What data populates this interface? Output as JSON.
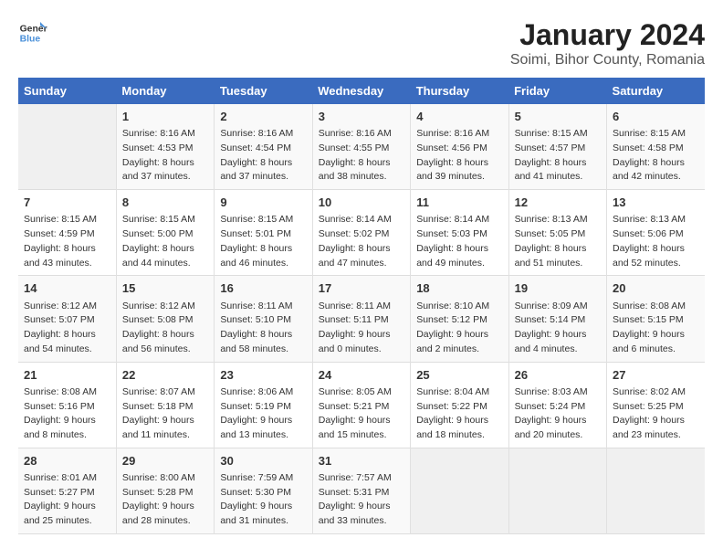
{
  "logo": {
    "text_general": "General",
    "text_blue": "Blue"
  },
  "title": "January 2024",
  "subtitle": "Soimi, Bihor County, Romania",
  "weekdays": [
    "Sunday",
    "Monday",
    "Tuesday",
    "Wednesday",
    "Thursday",
    "Friday",
    "Saturday"
  ],
  "weeks": [
    [
      {
        "day": "",
        "sunrise": "",
        "sunset": "",
        "daylight": ""
      },
      {
        "day": "1",
        "sunrise": "Sunrise: 8:16 AM",
        "sunset": "Sunset: 4:53 PM",
        "daylight": "Daylight: 8 hours and 37 minutes."
      },
      {
        "day": "2",
        "sunrise": "Sunrise: 8:16 AM",
        "sunset": "Sunset: 4:54 PM",
        "daylight": "Daylight: 8 hours and 37 minutes."
      },
      {
        "day": "3",
        "sunrise": "Sunrise: 8:16 AM",
        "sunset": "Sunset: 4:55 PM",
        "daylight": "Daylight: 8 hours and 38 minutes."
      },
      {
        "day": "4",
        "sunrise": "Sunrise: 8:16 AM",
        "sunset": "Sunset: 4:56 PM",
        "daylight": "Daylight: 8 hours and 39 minutes."
      },
      {
        "day": "5",
        "sunrise": "Sunrise: 8:15 AM",
        "sunset": "Sunset: 4:57 PM",
        "daylight": "Daylight: 8 hours and 41 minutes."
      },
      {
        "day": "6",
        "sunrise": "Sunrise: 8:15 AM",
        "sunset": "Sunset: 4:58 PM",
        "daylight": "Daylight: 8 hours and 42 minutes."
      }
    ],
    [
      {
        "day": "7",
        "sunrise": "Sunrise: 8:15 AM",
        "sunset": "Sunset: 4:59 PM",
        "daylight": "Daylight: 8 hours and 43 minutes."
      },
      {
        "day": "8",
        "sunrise": "Sunrise: 8:15 AM",
        "sunset": "Sunset: 5:00 PM",
        "daylight": "Daylight: 8 hours and 44 minutes."
      },
      {
        "day": "9",
        "sunrise": "Sunrise: 8:15 AM",
        "sunset": "Sunset: 5:01 PM",
        "daylight": "Daylight: 8 hours and 46 minutes."
      },
      {
        "day": "10",
        "sunrise": "Sunrise: 8:14 AM",
        "sunset": "Sunset: 5:02 PM",
        "daylight": "Daylight: 8 hours and 47 minutes."
      },
      {
        "day": "11",
        "sunrise": "Sunrise: 8:14 AM",
        "sunset": "Sunset: 5:03 PM",
        "daylight": "Daylight: 8 hours and 49 minutes."
      },
      {
        "day": "12",
        "sunrise": "Sunrise: 8:13 AM",
        "sunset": "Sunset: 5:05 PM",
        "daylight": "Daylight: 8 hours and 51 minutes."
      },
      {
        "day": "13",
        "sunrise": "Sunrise: 8:13 AM",
        "sunset": "Sunset: 5:06 PM",
        "daylight": "Daylight: 8 hours and 52 minutes."
      }
    ],
    [
      {
        "day": "14",
        "sunrise": "Sunrise: 8:12 AM",
        "sunset": "Sunset: 5:07 PM",
        "daylight": "Daylight: 8 hours and 54 minutes."
      },
      {
        "day": "15",
        "sunrise": "Sunrise: 8:12 AM",
        "sunset": "Sunset: 5:08 PM",
        "daylight": "Daylight: 8 hours and 56 minutes."
      },
      {
        "day": "16",
        "sunrise": "Sunrise: 8:11 AM",
        "sunset": "Sunset: 5:10 PM",
        "daylight": "Daylight: 8 hours and 58 minutes."
      },
      {
        "day": "17",
        "sunrise": "Sunrise: 8:11 AM",
        "sunset": "Sunset: 5:11 PM",
        "daylight": "Daylight: 9 hours and 0 minutes."
      },
      {
        "day": "18",
        "sunrise": "Sunrise: 8:10 AM",
        "sunset": "Sunset: 5:12 PM",
        "daylight": "Daylight: 9 hours and 2 minutes."
      },
      {
        "day": "19",
        "sunrise": "Sunrise: 8:09 AM",
        "sunset": "Sunset: 5:14 PM",
        "daylight": "Daylight: 9 hours and 4 minutes."
      },
      {
        "day": "20",
        "sunrise": "Sunrise: 8:08 AM",
        "sunset": "Sunset: 5:15 PM",
        "daylight": "Daylight: 9 hours and 6 minutes."
      }
    ],
    [
      {
        "day": "21",
        "sunrise": "Sunrise: 8:08 AM",
        "sunset": "Sunset: 5:16 PM",
        "daylight": "Daylight: 9 hours and 8 minutes."
      },
      {
        "day": "22",
        "sunrise": "Sunrise: 8:07 AM",
        "sunset": "Sunset: 5:18 PM",
        "daylight": "Daylight: 9 hours and 11 minutes."
      },
      {
        "day": "23",
        "sunrise": "Sunrise: 8:06 AM",
        "sunset": "Sunset: 5:19 PM",
        "daylight": "Daylight: 9 hours and 13 minutes."
      },
      {
        "day": "24",
        "sunrise": "Sunrise: 8:05 AM",
        "sunset": "Sunset: 5:21 PM",
        "daylight": "Daylight: 9 hours and 15 minutes."
      },
      {
        "day": "25",
        "sunrise": "Sunrise: 8:04 AM",
        "sunset": "Sunset: 5:22 PM",
        "daylight": "Daylight: 9 hours and 18 minutes."
      },
      {
        "day": "26",
        "sunrise": "Sunrise: 8:03 AM",
        "sunset": "Sunset: 5:24 PM",
        "daylight": "Daylight: 9 hours and 20 minutes."
      },
      {
        "day": "27",
        "sunrise": "Sunrise: 8:02 AM",
        "sunset": "Sunset: 5:25 PM",
        "daylight": "Daylight: 9 hours and 23 minutes."
      }
    ],
    [
      {
        "day": "28",
        "sunrise": "Sunrise: 8:01 AM",
        "sunset": "Sunset: 5:27 PM",
        "daylight": "Daylight: 9 hours and 25 minutes."
      },
      {
        "day": "29",
        "sunrise": "Sunrise: 8:00 AM",
        "sunset": "Sunset: 5:28 PM",
        "daylight": "Daylight: 9 hours and 28 minutes."
      },
      {
        "day": "30",
        "sunrise": "Sunrise: 7:59 AM",
        "sunset": "Sunset: 5:30 PM",
        "daylight": "Daylight: 9 hours and 31 minutes."
      },
      {
        "day": "31",
        "sunrise": "Sunrise: 7:57 AM",
        "sunset": "Sunset: 5:31 PM",
        "daylight": "Daylight: 9 hours and 33 minutes."
      },
      {
        "day": "",
        "sunrise": "",
        "sunset": "",
        "daylight": ""
      },
      {
        "day": "",
        "sunrise": "",
        "sunset": "",
        "daylight": ""
      },
      {
        "day": "",
        "sunrise": "",
        "sunset": "",
        "daylight": ""
      }
    ]
  ]
}
